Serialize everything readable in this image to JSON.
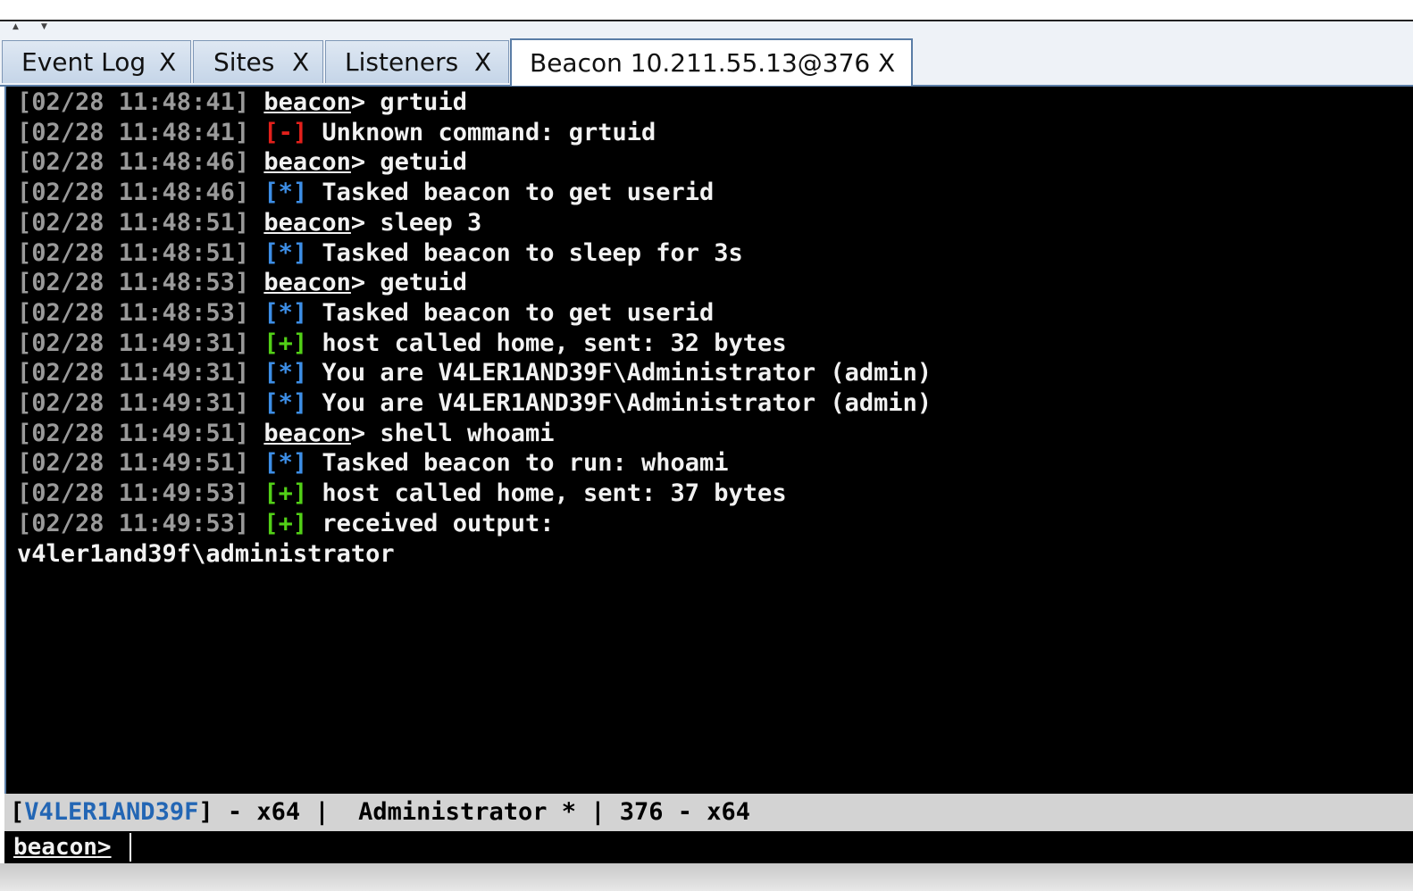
{
  "splitter": {
    "up_arrow": "▲",
    "down_arrow": "▼"
  },
  "tabs": [
    {
      "label": "Event Log",
      "close": "X",
      "active": false
    },
    {
      "label": "Sites",
      "close": "X",
      "active": false
    },
    {
      "label": "Listeners",
      "close": "X",
      "active": false
    },
    {
      "label": "Beacon 10.211.55.13@376",
      "close": "X",
      "active": true
    }
  ],
  "console": {
    "lines": [
      {
        "ts": "[02/28 11:48:41]",
        "kind": "prompt",
        "prompt": "beacon",
        "text": "> grtuid"
      },
      {
        "ts": "[02/28 11:48:41]",
        "kind": "err",
        "tag": "[-]",
        "text": " Unknown command: grtuid"
      },
      {
        "ts": "[02/28 11:48:46]",
        "kind": "prompt",
        "prompt": "beacon",
        "text": "> getuid"
      },
      {
        "ts": "[02/28 11:48:46]",
        "kind": "info",
        "tag": "[*]",
        "text": " Tasked beacon to get userid"
      },
      {
        "ts": "[02/28 11:48:51]",
        "kind": "prompt",
        "prompt": "beacon",
        "text": "> sleep 3"
      },
      {
        "ts": "[02/28 11:48:51]",
        "kind": "info",
        "tag": "[*]",
        "text": " Tasked beacon to sleep for 3s"
      },
      {
        "ts": "[02/28 11:48:53]",
        "kind": "prompt",
        "prompt": "beacon",
        "text": "> getuid"
      },
      {
        "ts": "[02/28 11:48:53]",
        "kind": "info",
        "tag": "[*]",
        "text": " Tasked beacon to get userid"
      },
      {
        "ts": "[02/28 11:49:31]",
        "kind": "ok",
        "tag": "[+]",
        "text": " host called home, sent: 32 bytes"
      },
      {
        "ts": "[02/28 11:49:31]",
        "kind": "info",
        "tag": "[*]",
        "text": " You are V4LER1AND39F\\Administrator (admin)"
      },
      {
        "ts": "[02/28 11:49:31]",
        "kind": "info",
        "tag": "[*]",
        "text": " You are V4LER1AND39F\\Administrator (admin)"
      },
      {
        "ts": "[02/28 11:49:51]",
        "kind": "prompt",
        "prompt": "beacon",
        "text": "> shell whoami"
      },
      {
        "ts": "[02/28 11:49:51]",
        "kind": "info",
        "tag": "[*]",
        "text": " Tasked beacon to run: whoami"
      },
      {
        "ts": "[02/28 11:49:53]",
        "kind": "ok",
        "tag": "[+]",
        "text": " host called home, sent: 37 bytes"
      },
      {
        "ts": "[02/28 11:49:53]",
        "kind": "ok",
        "tag": "[+]",
        "text": " received output:"
      },
      {
        "ts": "",
        "kind": "output",
        "text": "v4ler1and39f\\administrator"
      }
    ]
  },
  "status": {
    "open_bracket": "[",
    "host": "V4LER1AND39F",
    "rest": "] - x64 |  Administrator * | 376 - x64"
  },
  "input": {
    "prompt": "beacon",
    "prompt_suffix": ">",
    "value": ""
  },
  "colors": {
    "background": "#000000",
    "timestamp": "#9a9a9a",
    "error": "#e3201b",
    "info": "#3d8ee6",
    "success": "#52d017",
    "host": "#2366b4",
    "tab_border": "#5a7da6"
  }
}
